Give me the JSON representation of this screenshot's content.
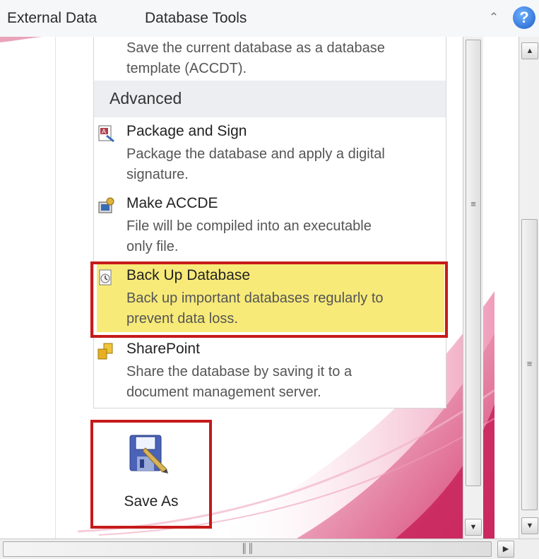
{
  "ribbon": {
    "tabs": [
      "External Data",
      "Database Tools"
    ],
    "collapse_icon": "chevron-up-icon",
    "help_label": "?"
  },
  "panel": {
    "top_item_desc_line1": "Save the current database as a database",
    "top_item_desc_line2": "template (ACCDT).",
    "section_label": "Advanced",
    "items": [
      {
        "title": "Package and Sign",
        "desc1": "Package the database and apply a digital",
        "desc2": "signature.",
        "icon": "package-sign-icon"
      },
      {
        "title": "Make ACCDE",
        "desc1": "File will be compiled into an executable",
        "desc2": "only file.",
        "icon": "make-accde-icon"
      },
      {
        "title": "Back Up Database",
        "desc1": "Back up important databases regularly to",
        "desc2": "prevent data loss.",
        "icon": "backup-database-icon"
      },
      {
        "title": "SharePoint",
        "desc1": "Share the database by saving it to a",
        "desc2": "document management server.",
        "icon": "sharepoint-icon"
      }
    ]
  },
  "save_as": {
    "label": "Save As",
    "icon": "save-as-icon"
  },
  "colors": {
    "highlight_border": "#c61a1a",
    "highlight_fill": "#f7ea79",
    "accent": "#c8235a"
  }
}
